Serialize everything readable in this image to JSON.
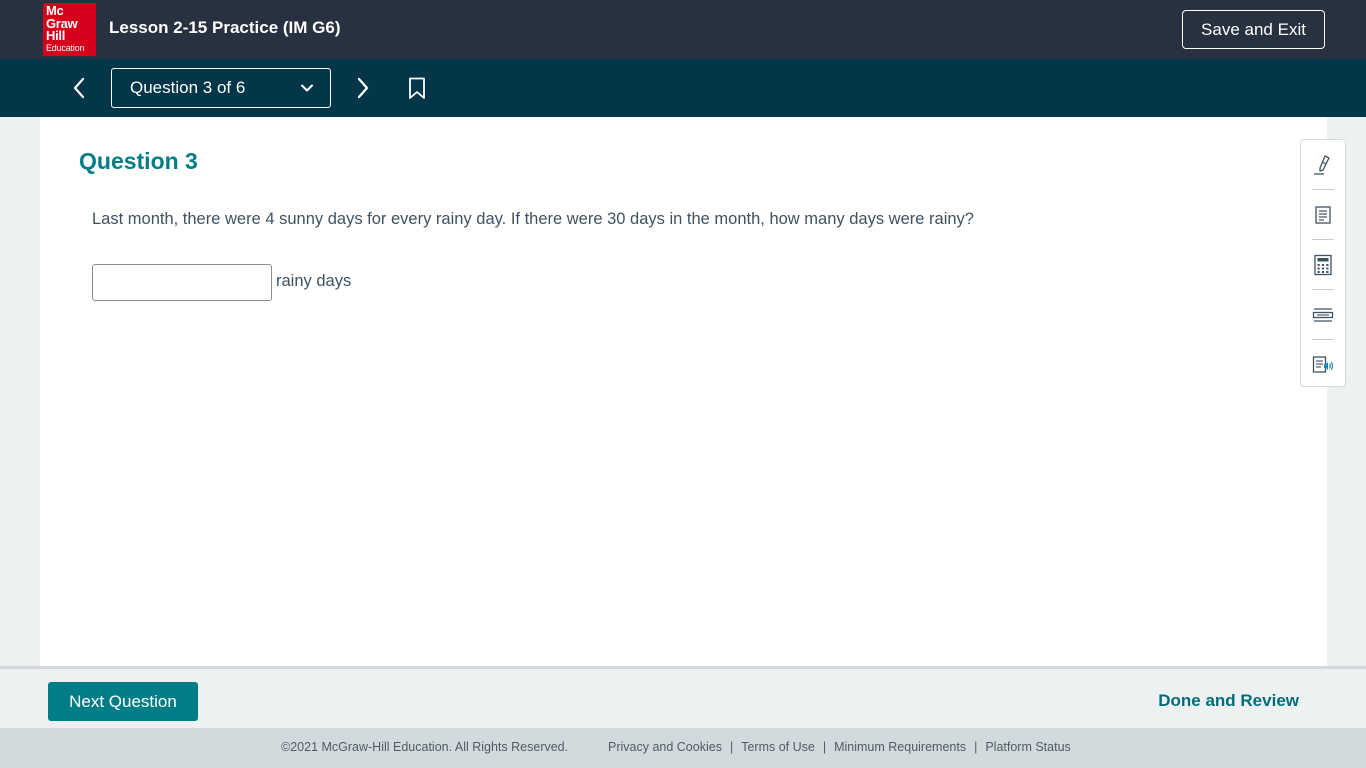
{
  "header": {
    "logo_lines": [
      "Mc",
      "Graw",
      "Hill",
      "Education"
    ],
    "lesson_title": "Lesson 2-15 Practice (IM G6)",
    "save_exit_label": "Save and Exit"
  },
  "nav": {
    "question_selector_label": "Question 3 of 6",
    "prev_icon": "chevron-left-icon",
    "next_icon": "chevron-right-icon",
    "bookmark_icon": "bookmark-icon"
  },
  "question": {
    "heading": "Question 3",
    "text": "Last month, there were 4 sunny days for every rainy day. If there were 30 days in the month, how many days were rainy?",
    "answer_value": "",
    "answer_unit": "rainy days"
  },
  "tools": [
    {
      "icon": "highlighter-pen-icon"
    },
    {
      "icon": "notepad-icon"
    },
    {
      "icon": "calculator-icon"
    },
    {
      "icon": "line-reader-icon"
    },
    {
      "icon": "text-to-speech-icon"
    }
  ],
  "footer": {
    "next_question_label": "Next Question",
    "done_review_label": "Done and Review"
  },
  "legal": {
    "copyright": "©2021 McGraw-Hill Education. All Rights Reserved.",
    "links": [
      "Privacy and Cookies",
      "Terms of Use",
      "Minimum Requirements",
      "Platform Status"
    ],
    "separator": "|"
  },
  "colors": {
    "header_bg": "#27313f",
    "nav_bg": "#033648",
    "accent_teal": "#007d86",
    "logo_red": "#d6001c"
  }
}
